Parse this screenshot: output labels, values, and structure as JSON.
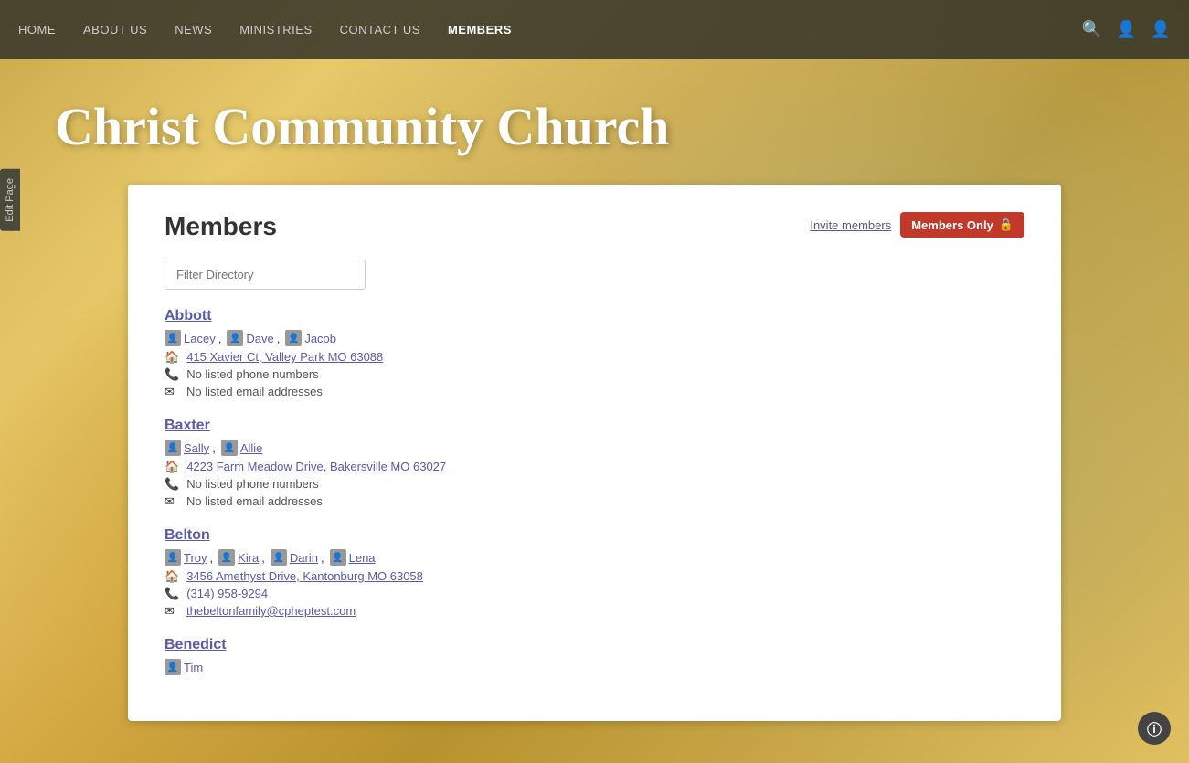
{
  "nav": {
    "links": [
      {
        "label": "HOME",
        "active": false,
        "key": "home"
      },
      {
        "label": "ABOUT US",
        "active": false,
        "key": "about"
      },
      {
        "label": "NEWS",
        "active": false,
        "key": "news"
      },
      {
        "label": "MINISTRIES",
        "active": false,
        "key": "ministries"
      },
      {
        "label": "CONTACT US",
        "active": false,
        "key": "contact"
      },
      {
        "label": "MEMBERS",
        "active": true,
        "key": "members"
      }
    ]
  },
  "hero": {
    "title": "Christ Community Church"
  },
  "edit_page": "Edit Page",
  "page": {
    "title": "Members",
    "invite_label": "Invite members",
    "members_only_label": "Members Only",
    "filter_placeholder": "Filter Directory"
  },
  "families": [
    {
      "name": "Abbott",
      "members": [
        {
          "name": "Lacey",
          "sep": true
        },
        {
          "name": "Dave",
          "sep": true
        },
        {
          "name": "Jacob",
          "sep": false
        }
      ],
      "address": "415 Xavier Ct, Valley Park MO 63088",
      "phone": "No listed phone numbers",
      "email": "No listed email addresses"
    },
    {
      "name": "Baxter",
      "members": [
        {
          "name": "Sally",
          "sep": true
        },
        {
          "name": "Allie",
          "sep": false
        }
      ],
      "address": "4223 Farm Meadow Drive, Bakersville MO 63027",
      "phone": "No listed phone numbers",
      "email": "No listed email addresses"
    },
    {
      "name": "Belton",
      "members": [
        {
          "name": "Troy",
          "sep": true
        },
        {
          "name": "Kira",
          "sep": true
        },
        {
          "name": "Darin",
          "sep": true
        },
        {
          "name": "Lena",
          "sep": false
        }
      ],
      "address": "3456 Amethyst Drive, Kantonburg MO 63058",
      "phone": "(314) 958-9294",
      "email": "thebeltonfamily@cpheptest.com"
    },
    {
      "name": "Benedict",
      "members": [
        {
          "name": "Tim",
          "sep": false
        }
      ],
      "address": null,
      "phone": null,
      "email": null
    }
  ]
}
